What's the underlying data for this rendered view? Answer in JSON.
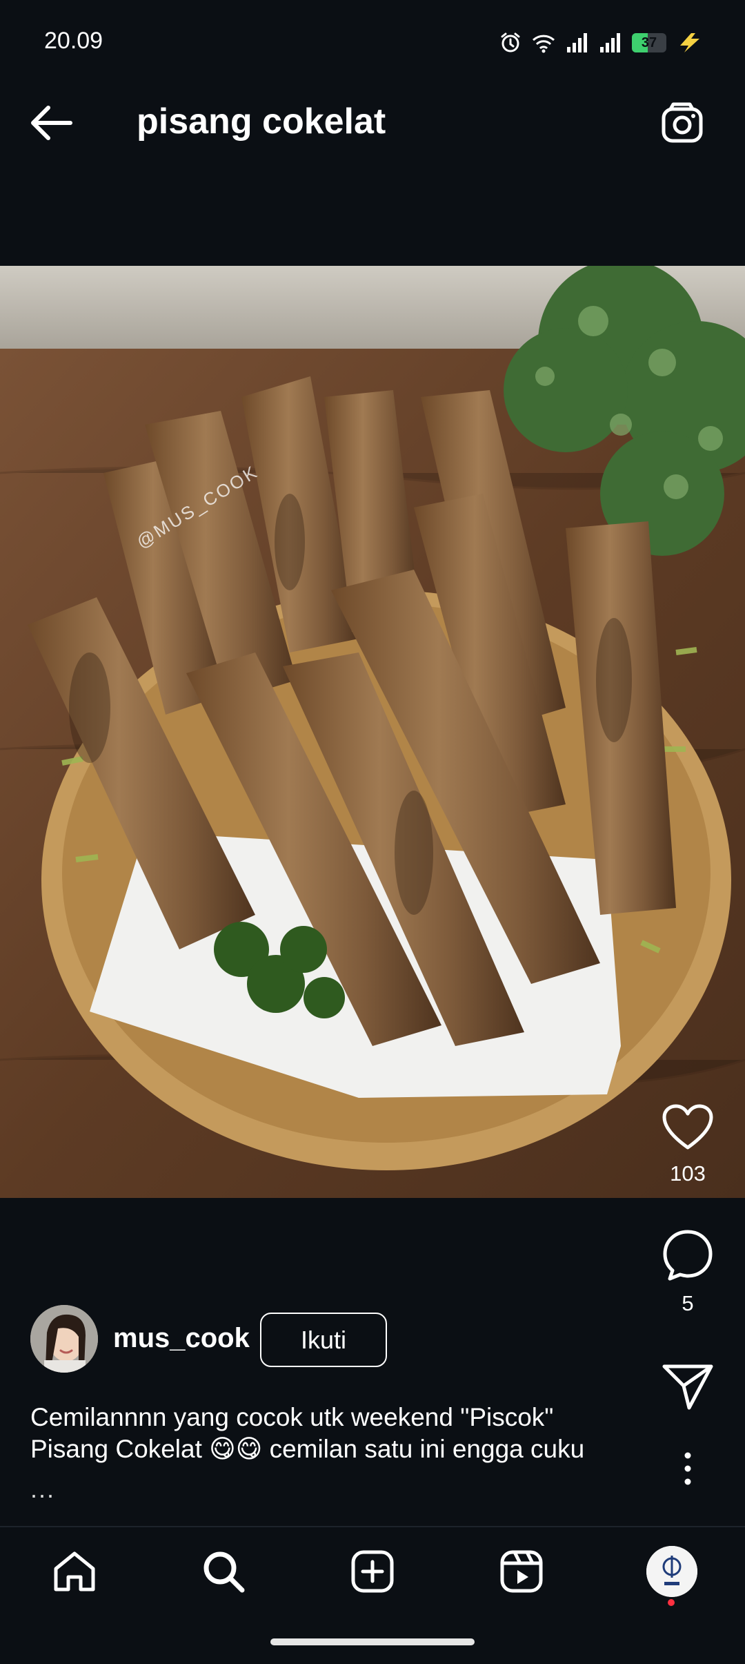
{
  "status_bar": {
    "time": "20.09",
    "battery_level": "37",
    "icons": [
      "alarm-icon",
      "wifi-icon",
      "signal-icon",
      "signal-icon",
      "battery-icon",
      "charging-icon"
    ]
  },
  "header": {
    "title": "pisang cokelat",
    "back_icon": "arrow-left-icon",
    "camera_icon": "camera-icon"
  },
  "post": {
    "image_description_icon": "post-photo",
    "watermark": "@MUS_COOK",
    "likes": "103",
    "comments": "5",
    "author": {
      "username": "mus_cook",
      "follow_label": "Ikuti"
    },
    "caption_lines": [
      "Cemilannnn yang cocok utk weekend \"Piscok\"",
      "Pisang Cokelat 😋😋 cemilan satu ini engga cuku"
    ],
    "caption_more": "..."
  },
  "nav": {
    "items": [
      "home-icon",
      "search-icon",
      "create-icon",
      "reels-icon",
      "profile-avatar"
    ]
  },
  "colors": {
    "background": "#0b0f14",
    "text": "#ffffff",
    "notification_dot": "#ff3040",
    "battery_fill": "#3ecf6e",
    "charging": "#f5d142"
  }
}
